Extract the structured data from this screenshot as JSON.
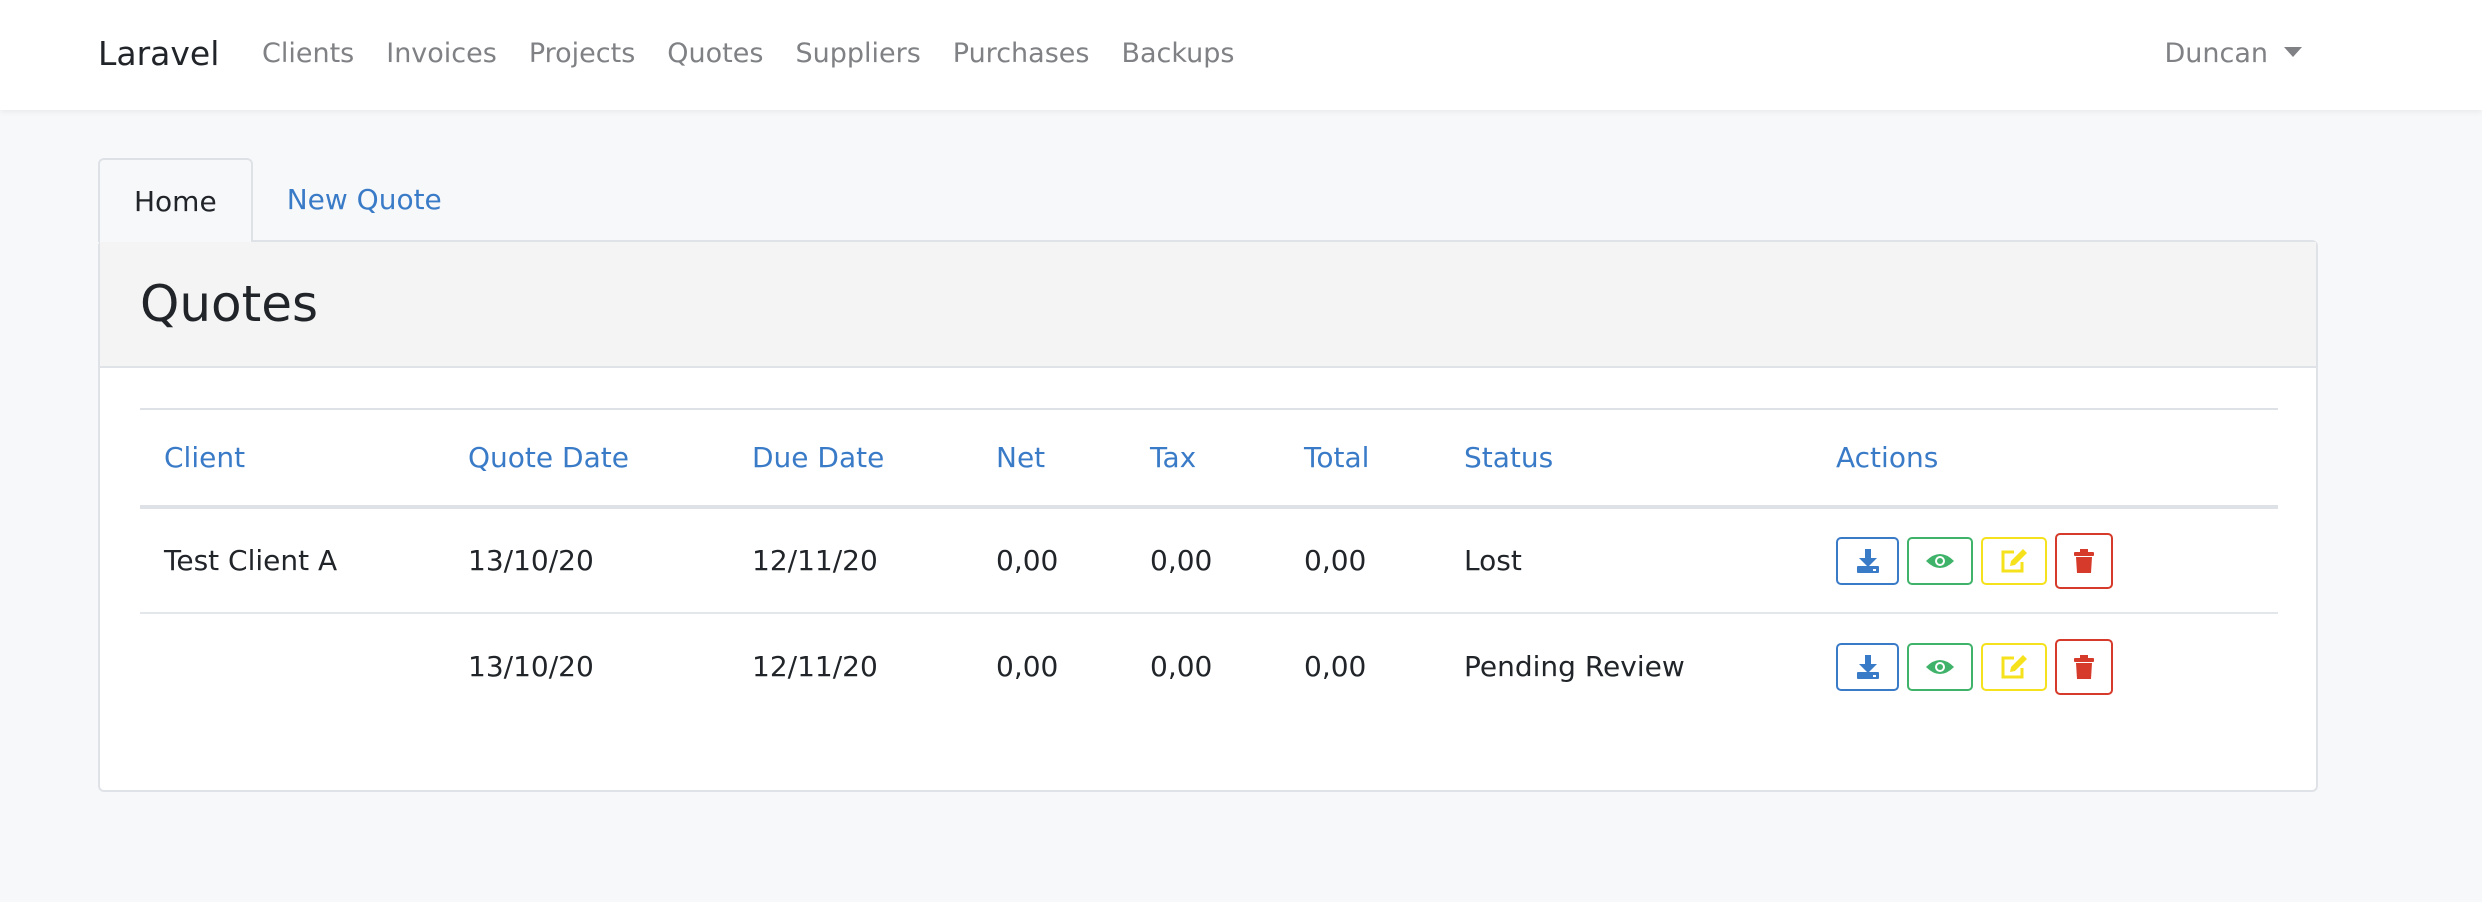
{
  "navbar": {
    "brand": "Laravel",
    "links": [
      "Clients",
      "Invoices",
      "Projects",
      "Quotes",
      "Suppliers",
      "Purchases",
      "Backups"
    ],
    "user": "Duncan"
  },
  "tabs": {
    "home": "Home",
    "new_quote": "New Quote"
  },
  "card": {
    "title": "Quotes"
  },
  "table": {
    "headers": [
      "Client",
      "Quote Date",
      "Due Date",
      "Net",
      "Tax",
      "Total",
      "Status",
      "Actions"
    ],
    "rows": [
      {
        "client": "Test Client A",
        "quote_date": "13/10/20",
        "due_date": "12/11/20",
        "net": "0,00",
        "tax": "0,00",
        "total": "0,00",
        "status": "Lost"
      },
      {
        "client": "",
        "quote_date": "13/10/20",
        "due_date": "12/11/20",
        "net": "0,00",
        "tax": "0,00",
        "total": "0,00",
        "status": "Pending Review"
      }
    ]
  },
  "icons": {
    "download": "download-icon",
    "view": "eye-icon",
    "edit": "edit-icon",
    "delete": "trash-icon"
  },
  "colors": {
    "link": "#3a7bc8",
    "success": "#3fb36a",
    "warning": "#f5e11c",
    "danger": "#d63a2a"
  }
}
